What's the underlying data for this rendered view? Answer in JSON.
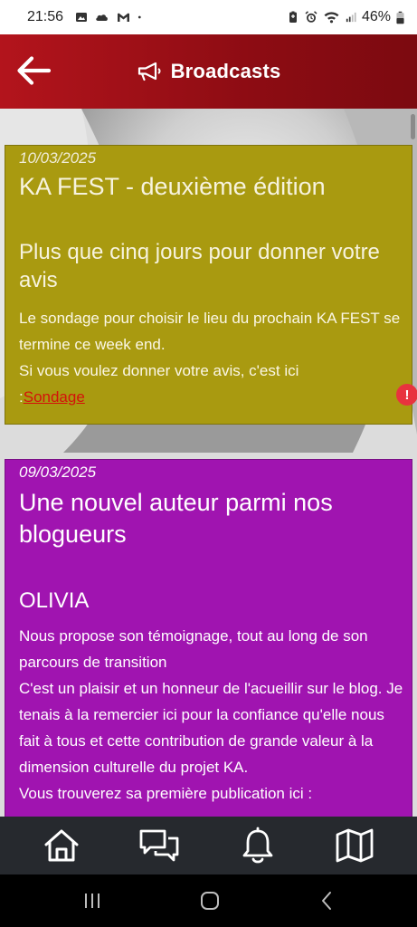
{
  "status_bar": {
    "time": "21:56",
    "battery": "46%",
    "left_icons": [
      "gallery-icon",
      "cloud-icon",
      "gmail-icon",
      "dot-icon"
    ],
    "right_icons": [
      "battery-saver-icon",
      "alarm-icon",
      "wifi-icon",
      "signal-icon",
      "battery-icon"
    ]
  },
  "header": {
    "title": "Broadcasts",
    "icon": "megaphone-icon",
    "back_icon": "arrow-left-icon",
    "color": "#a3111a"
  },
  "broadcasts": [
    {
      "date": "10/03/2025",
      "title": "KA FEST - deuxième édition",
      "subtitle": "Plus que cinq jours pour donner votre avis",
      "body_lines": [
        "Le sondage pour choisir le lieu du prochain KA FEST se termine ce week end.",
        "Si vous voulez donner votre avis, c'est ici"
      ],
      "link_prefix": ":",
      "link_text": "Sondage",
      "color": "#a99a10"
    },
    {
      "date": "09/03/2025",
      "title": "Une nouvel auteur parmi nos blogueurs",
      "subtitle": "OLIVIA",
      "body_lines": [
        "Nous propose son témoignage, tout au long de son parcours de transition",
        "C'est un plaisir et un honneur de l'acueillir sur le blog. Je tenais à la remercier ici pour la confiance qu'elle nous fait à tous et cette contribution de grande valeur à la dimension culturelle du projet KA.",
        "Vous trouverez sa première publication ici :"
      ],
      "color": "#a014b0"
    }
  ],
  "alert_badge": "!",
  "bottom_nav": {
    "items": [
      {
        "icon": "home-icon"
      },
      {
        "icon": "chat-icon"
      },
      {
        "icon": "bell-icon"
      },
      {
        "icon": "map-icon"
      }
    ]
  },
  "system_nav": {
    "items": [
      {
        "icon": "recents-icon"
      },
      {
        "icon": "home-circle-icon"
      },
      {
        "icon": "back-chevron-icon"
      }
    ]
  }
}
